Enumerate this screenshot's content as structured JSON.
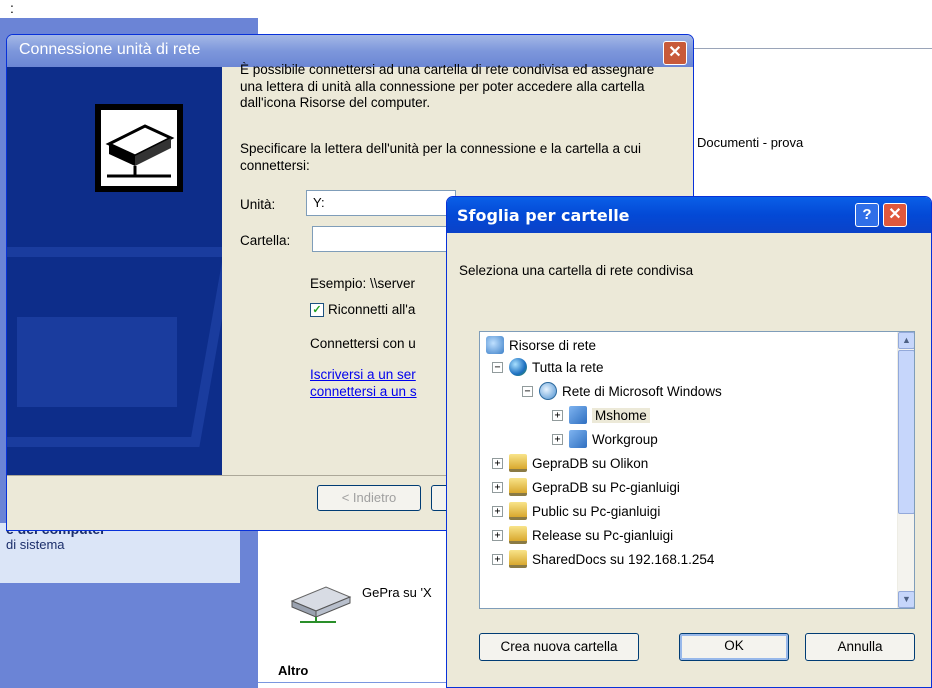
{
  "top_colon": ":",
  "background": {
    "left_title": "e del computer",
    "left_sub": "di sistema",
    "doc_text": "Documenti - prova",
    "drive_label": "GePra su 'X",
    "altro": "Altro"
  },
  "dialog_connect": {
    "title": "Connessione unità di rete",
    "close_glyph": "✕",
    "paragraph1": "È possibile connettersi ad una cartella di rete condivisa ed assegnare una lettera di unità alla connessione per poter accedere alla cartella dall'icona Risorse del computer.",
    "paragraph2": "Specificare la lettera dell'unità per la connessione e la cartella a cui connettersi:",
    "unita_label": "Unità:",
    "unita_value": "Y:",
    "cartella_label": "Cartella:",
    "cartella_value": "",
    "esempio": "Esempio: \\\\server",
    "riconnetti": "Riconnetti all'a",
    "connettersi": "Connettersi con u",
    "link1": "Iscriversi a un ser",
    "link2": "connettersi a un s",
    "back_button": "< Indietro"
  },
  "dialog_browse": {
    "title": "Sfoglia per cartelle",
    "help_glyph": "?",
    "close_glyph": "✕",
    "description": "Seleziona una cartella di rete condivisa",
    "tree": [
      {
        "label": "Risorse di rete",
        "icon": "network-places-icon",
        "expander": ""
      },
      {
        "label": "Tutta la rete",
        "icon": "globe-icon",
        "expander": "−"
      },
      {
        "label": "Rete di Microsoft Windows",
        "icon": "microsoft-network-icon",
        "expander": "−"
      },
      {
        "label": "Mshome",
        "icon": "workgroup-icon",
        "expander": "+"
      },
      {
        "label": "Workgroup",
        "icon": "workgroup-icon",
        "expander": "+"
      },
      {
        "label": "GepraDB su Olikon",
        "icon": "shared-folder-icon",
        "expander": "+"
      },
      {
        "label": "GepraDB su Pc-gianluigi",
        "icon": "shared-folder-icon",
        "expander": "+"
      },
      {
        "label": "Public su Pc-gianluigi",
        "icon": "shared-folder-icon",
        "expander": "+"
      },
      {
        "label": "Release su Pc-gianluigi",
        "icon": "shared-folder-icon",
        "expander": "+"
      },
      {
        "label": "SharedDocs su 192.168.1.254",
        "icon": "shared-folder-icon",
        "expander": "+"
      }
    ],
    "new_folder_button": "Crea nuova cartella",
    "ok_button": "OK",
    "cancel_button": "Annulla"
  }
}
